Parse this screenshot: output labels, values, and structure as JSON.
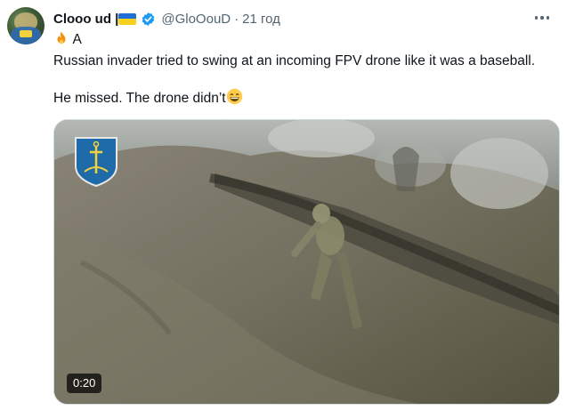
{
  "tweet": {
    "author_name": "Clooo ud |",
    "handle": "@GloOouD",
    "dot": "·",
    "time": "21 год",
    "text_line1_a": " A ",
    "text_line1_b": "Russian invader tried to swing at an incoming FPV drone like it was a baseball.",
    "text_line2": "He missed. The drone didn’t",
    "more_menu": "more-options"
  },
  "media": {
    "duration": "0:20",
    "kind": "video"
  },
  "icons": {
    "fire": "fire-icon",
    "flag_ru": "russia-flag-icon",
    "flag_ua": "ukraine-flag-icon",
    "verified": "verified-badge-icon",
    "grin": "grinning-face-icon",
    "emblem": "navy-anchor-emblem"
  },
  "colors": {
    "text": "#0f1419",
    "secondary": "#536471",
    "verified": "#1d9bf0",
    "ua_blue": "#1f6fd6",
    "ua_yellow": "#f7d21c"
  }
}
